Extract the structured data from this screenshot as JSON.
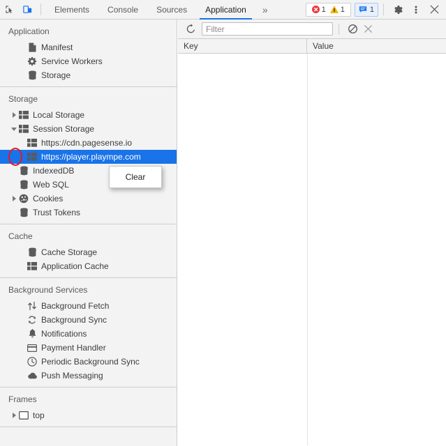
{
  "toolbar": {
    "inspect_icon": "inspect-element-icon",
    "device_icon": "device-toolbar-icon",
    "tabs": [
      {
        "label": "Elements",
        "active": false
      },
      {
        "label": "Console",
        "active": false
      },
      {
        "label": "Sources",
        "active": false
      },
      {
        "label": "Application",
        "active": true
      }
    ],
    "more_tabs": "»",
    "errors": {
      "icon": "error-icon",
      "count": "1"
    },
    "warnings": {
      "icon": "warning-icon",
      "count": "1"
    },
    "messages": {
      "icon": "message-icon",
      "count": "1"
    },
    "settings_icon": "gear-icon",
    "menu_icon": "kebab-menu-icon",
    "close_icon": "close-icon",
    "accent": "#1a73e8"
  },
  "sidebar": {
    "sections": [
      {
        "title": "Application",
        "items": [
          {
            "label": "Manifest",
            "icon": "document-icon",
            "indent": 2,
            "arrow": "none"
          },
          {
            "label": "Service Workers",
            "icon": "gear-icon",
            "indent": 2,
            "arrow": "none"
          },
          {
            "label": "Storage",
            "icon": "database-icon",
            "indent": 2,
            "arrow": "none"
          }
        ]
      },
      {
        "title": "Storage",
        "items": [
          {
            "label": "Local Storage",
            "icon": "table-icon",
            "indent": 1,
            "arrow": "collapsed"
          },
          {
            "label": "Session Storage",
            "icon": "table-icon",
            "indent": 1,
            "arrow": "expanded",
            "annotated": true
          },
          {
            "label": "https://cdn.pagesense.io",
            "icon": "table-icon",
            "indent": 2,
            "arrow": "none"
          },
          {
            "label": "https://player.plaympe.com",
            "icon": "table-icon",
            "indent": 2,
            "arrow": "none",
            "selected": true
          },
          {
            "label": "IndexedDB",
            "icon": "database-icon",
            "indent": 1,
            "arrow": "none"
          },
          {
            "label": "Web SQL",
            "icon": "database-icon",
            "indent": 1,
            "arrow": "none"
          },
          {
            "label": "Cookies",
            "icon": "cookie-icon",
            "indent": 1,
            "arrow": "collapsed"
          },
          {
            "label": "Trust Tokens",
            "icon": "database-icon",
            "indent": 1,
            "arrow": "none"
          }
        ]
      },
      {
        "title": "Cache",
        "items": [
          {
            "label": "Cache Storage",
            "icon": "database-icon",
            "indent": 2,
            "arrow": "none"
          },
          {
            "label": "Application Cache",
            "icon": "table-icon",
            "indent": 2,
            "arrow": "none"
          }
        ]
      },
      {
        "title": "Background Services",
        "items": [
          {
            "label": "Background Fetch",
            "icon": "updown-arrows-icon",
            "indent": 2,
            "arrow": "none"
          },
          {
            "label": "Background Sync",
            "icon": "sync-icon",
            "indent": 2,
            "arrow": "none"
          },
          {
            "label": "Notifications",
            "icon": "bell-icon",
            "indent": 2,
            "arrow": "none"
          },
          {
            "label": "Payment Handler",
            "icon": "credit-card-icon",
            "indent": 2,
            "arrow": "none"
          },
          {
            "label": "Periodic Background Sync",
            "icon": "clock-icon",
            "indent": 2,
            "arrow": "none"
          },
          {
            "label": "Push Messaging",
            "icon": "cloud-icon",
            "indent": 2,
            "arrow": "none"
          }
        ]
      },
      {
        "title": "Frames",
        "items": [
          {
            "label": "top",
            "icon": "frame-icon",
            "indent": 1,
            "arrow": "collapsed"
          }
        ]
      }
    ]
  },
  "context_menu": {
    "items": [
      {
        "label": "Clear"
      }
    ]
  },
  "main": {
    "refresh_icon": "refresh-icon",
    "filter": {
      "placeholder": "Filter",
      "value": ""
    },
    "clear_icon": "no-entry-icon",
    "close_icon": "close-icon",
    "columns": [
      {
        "label": "Key"
      },
      {
        "label": "Value"
      }
    ],
    "rows": []
  }
}
